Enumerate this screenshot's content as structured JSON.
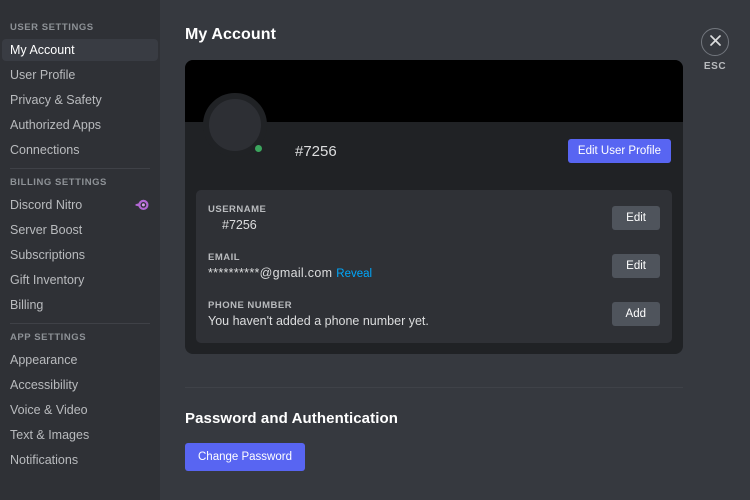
{
  "sidebar": {
    "sections": [
      {
        "heading": "USER SETTINGS",
        "items": [
          {
            "label": "My Account",
            "active": true
          },
          {
            "label": "User Profile",
            "active": false
          },
          {
            "label": "Privacy & Safety",
            "active": false
          },
          {
            "label": "Authorized Apps",
            "active": false
          },
          {
            "label": "Connections",
            "active": false
          }
        ]
      },
      {
        "heading": "BILLING SETTINGS",
        "items": [
          {
            "label": "Discord Nitro",
            "active": false,
            "badge": "nitro-badge-icon"
          },
          {
            "label": "Server Boost",
            "active": false
          },
          {
            "label": "Subscriptions",
            "active": false
          },
          {
            "label": "Gift Inventory",
            "active": false
          },
          {
            "label": "Billing",
            "active": false
          }
        ]
      },
      {
        "heading": "APP SETTINGS",
        "items": [
          {
            "label": "Appearance",
            "active": false
          },
          {
            "label": "Accessibility",
            "active": false
          },
          {
            "label": "Voice & Video",
            "active": false
          },
          {
            "label": "Text & Images",
            "active": false
          },
          {
            "label": "Notifications",
            "active": false
          }
        ]
      }
    ]
  },
  "main": {
    "page_title": "My Account",
    "account_card": {
      "display_name": "#7256",
      "status": "online",
      "edit_profile_label": "Edit User Profile",
      "fields": [
        {
          "label": "USERNAME",
          "value": "#7256",
          "action_label": "Edit",
          "action_style": "grey",
          "indent": true
        },
        {
          "label": "EMAIL",
          "value": "**********@gmail.com",
          "reveal_label": "Reveal",
          "action_label": "Edit",
          "action_style": "grey",
          "indent": false
        },
        {
          "label": "PHONE NUMBER",
          "value": "You haven't added a phone number yet.",
          "action_label": "Add",
          "action_style": "grey",
          "indent": false
        }
      ]
    },
    "password_section": {
      "title": "Password and Authentication",
      "change_password_label": "Change Password"
    }
  },
  "close": {
    "icon": "close-icon",
    "label": "ESC"
  },
  "colors": {
    "blurple": "#5865f2",
    "online_green": "#3ba55d",
    "link_blue": "#00a8fc",
    "sidebar_bg": "#2f3136",
    "main_bg": "#36393f",
    "card_bg": "#202225",
    "grey_button": "#4f545c",
    "nitro_purple": "#b267d4"
  }
}
